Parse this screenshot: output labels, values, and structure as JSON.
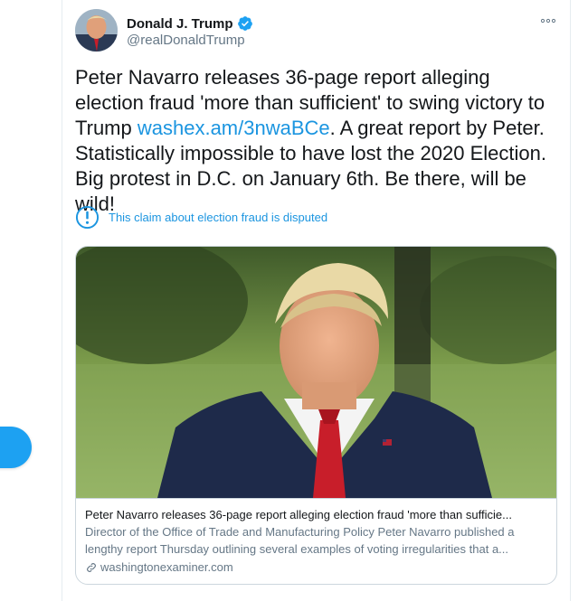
{
  "tweet": {
    "author": {
      "display_name": "Donald J. Trump",
      "handle": "@realDonaldTrump",
      "verified": true
    },
    "text_before_link": "Peter Navarro releases 36-page report alleging election fraud 'more than sufficient' to swing victory to Trump ",
    "link_text": "washex.am/3nwaBCe",
    "text_after_link": ". A great report by Peter. Statistically impossible to have lost the 2020 Election. Big protest in D.C. on January 6th. Be there, will be wild!",
    "disputed_label": "This claim about election fraud is disputed"
  },
  "card": {
    "title": "Peter Navarro releases 36-page report alleging election fraud 'more than sufficie...",
    "description": "Director of the Office of Trade and Manufacturing Policy Peter Navarro published a lengthy report Thursday outlining several examples of voting irregularities that a...",
    "domain": "washingtonexaminer.com"
  },
  "colors": {
    "accent": "#1da1f2",
    "link": "#1b95e0",
    "secondary_text": "#657786",
    "border": "#ccd6dd"
  },
  "icons": {
    "verified": "verified-badge-icon",
    "more": "more-dots-icon",
    "disputed": "exclamation-circle-icon",
    "link": "link-chain-icon"
  }
}
